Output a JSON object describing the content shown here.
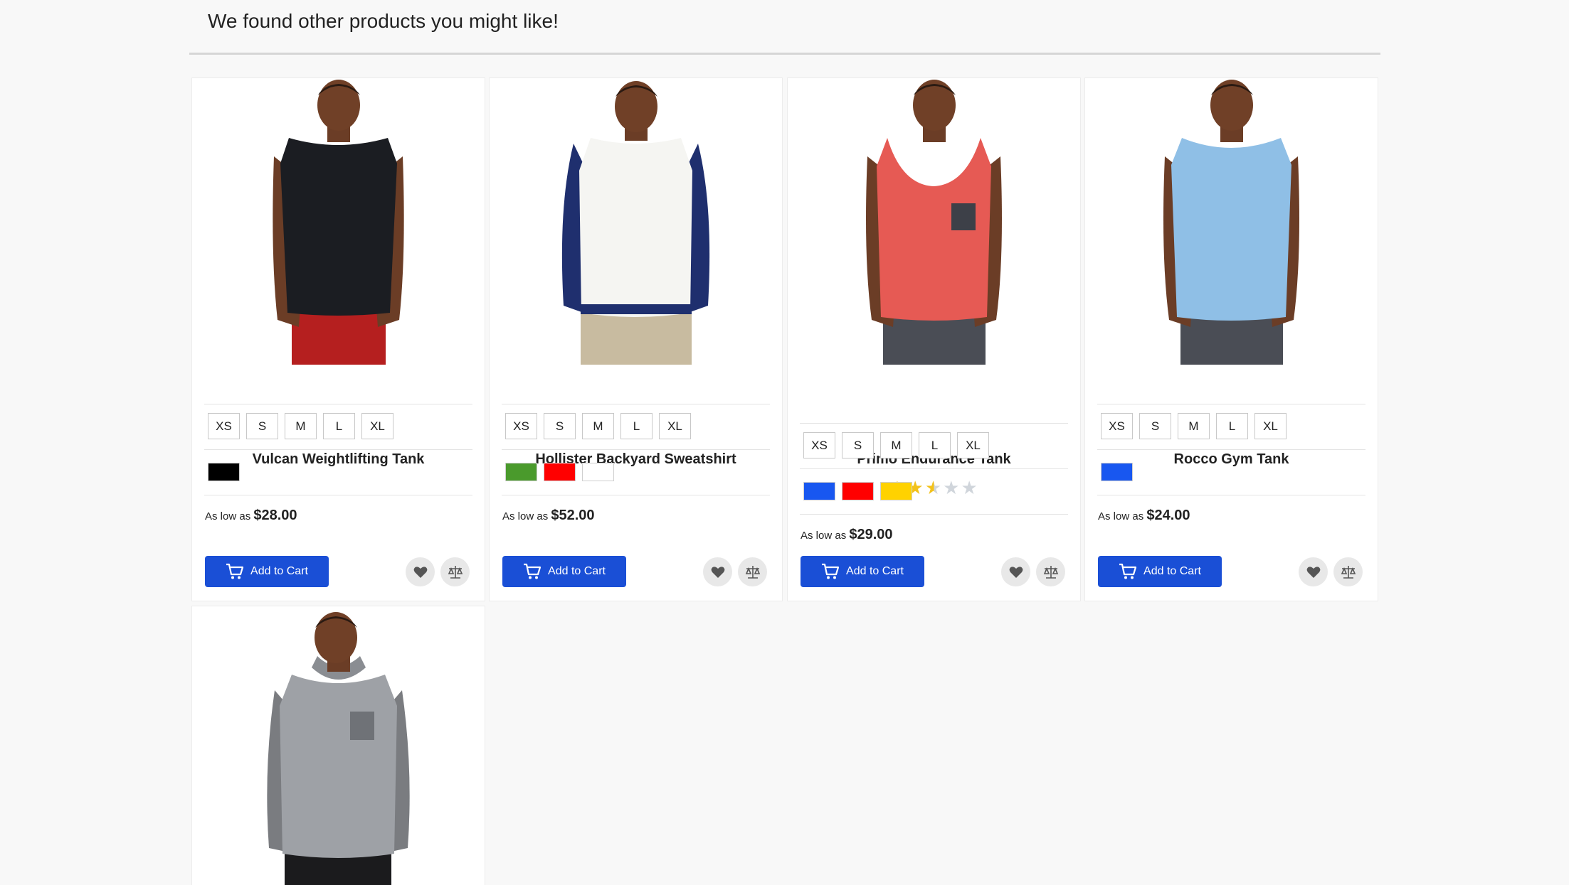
{
  "section": {
    "title": "We found other products you might like!"
  },
  "price_prefix": "As low as",
  "add_to_cart_label": "Add to Cart",
  "products": [
    {
      "name": "Vulcan Weightlifting Tank",
      "sizes": [
        "XS",
        "S",
        "M",
        "L",
        "XL"
      ],
      "colors": [
        "#000000"
      ],
      "price": "$28.00",
      "rating_stars": null,
      "icons": [
        "cart-icon",
        "heart-icon",
        "compare-scale-icon"
      ]
    },
    {
      "name": "Hollister Backyard Sweatshirt",
      "sizes": [
        "XS",
        "S",
        "M",
        "L",
        "XL"
      ],
      "colors": [
        "#4a9a2c",
        "#ff0000",
        "#ffffff"
      ],
      "price": "$52.00",
      "rating_stars": null,
      "icons": [
        "cart-icon",
        "heart-icon",
        "compare-scale-icon"
      ]
    },
    {
      "name": "Primo Endurance Tank",
      "sizes": [
        "XS",
        "S",
        "M",
        "L",
        "XL"
      ],
      "colors": [
        "#1857f0",
        "#ff0000",
        "#ffd200"
      ],
      "price": "$29.00",
      "rating_stars": 2.5,
      "icons": [
        "cart-icon",
        "heart-icon",
        "compare-scale-icon"
      ]
    },
    {
      "name": "Rocco Gym Tank",
      "sizes": [
        "XS",
        "S",
        "M",
        "L",
        "XL"
      ],
      "colors": [
        "#1857f0"
      ],
      "price": "$24.00",
      "rating_stars": null,
      "icons": [
        "cart-icon",
        "heart-icon",
        "compare-scale-icon"
      ]
    },
    {
      "name": "",
      "sizes": [],
      "colors": [],
      "price": "",
      "rating_stars": null,
      "icons": []
    }
  ],
  "colors": {
    "accent": "#1a4fd6",
    "page_bg": "#f8f8f8",
    "card_bg": "#ffffff"
  }
}
